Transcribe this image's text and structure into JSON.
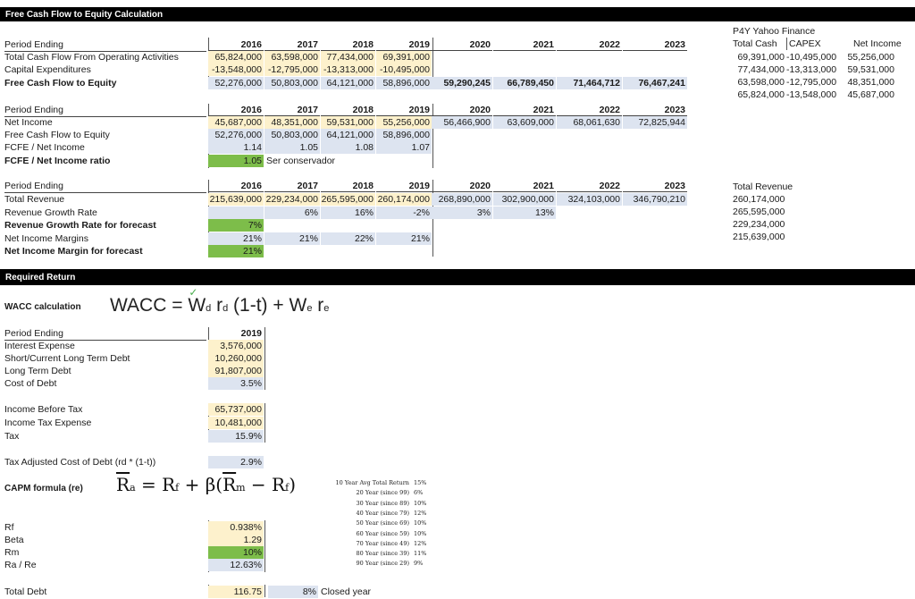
{
  "fcfe": {
    "title": "Free Cash Flow to Equity Calculation",
    "header": "Period Ending",
    "years": [
      "2016",
      "2017",
      "2018",
      "2019",
      "2020",
      "2021",
      "2022",
      "2023"
    ],
    "rows": [
      {
        "label": "Total Cash Flow From Operating Activities",
        "values": [
          "65,824,000",
          "63,598,000",
          "77,434,000",
          "69,391,000"
        ]
      },
      {
        "label": "Capital Expenditures",
        "values": [
          "-13,548,000",
          "-12,795,000",
          "-13,313,000",
          "-10,495,000"
        ]
      },
      {
        "label": "Free Cash Flow to Equity",
        "values": [
          "52,276,000",
          "50,803,000",
          "64,121,000",
          "58,896,000",
          "59,290,245",
          "66,789,450",
          "71,464,712",
          "76,467,241"
        ]
      }
    ]
  },
  "yahoo": {
    "title": "P4Y Yahoo Finance",
    "h1": "Total Cash",
    "h2": "CAPEX",
    "h3": "Net Income",
    "rows": [
      [
        "69,391,000",
        "-10,495,000",
        "55,256,000"
      ],
      [
        "77,434,000",
        "-13,313,000",
        "59,531,000"
      ],
      [
        "63,598,000",
        "-12,795,000",
        "48,351,000"
      ],
      [
        "65,824,000",
        "-13,548,000",
        "45,687,000"
      ]
    ]
  },
  "ni": {
    "header": "Period Ending",
    "years": [
      "2016",
      "2017",
      "2018",
      "2019",
      "2020",
      "2021",
      "2022",
      "2023"
    ],
    "net_income_label": "Net Income",
    "net_income": [
      "45,687,000",
      "48,351,000",
      "59,531,000",
      "55,256,000",
      "56,466,900",
      "63,609,000",
      "68,061,630",
      "72,825,944"
    ],
    "fcfe_label": "Free Cash Flow to Equity",
    "fcfe": [
      "52,276,000",
      "50,803,000",
      "64,121,000",
      "58,896,000"
    ],
    "ratio_label": "FCFE / Net Income",
    "ratio": [
      "1.14",
      "1.05",
      "1.08",
      "1.07"
    ],
    "ratio_forecast_label": "FCFE / Net Income ratio",
    "ratio_forecast": "1.05",
    "note": "Ser conservador"
  },
  "rev": {
    "header": "Period Ending",
    "years": [
      "2016",
      "2017",
      "2018",
      "2019",
      "2020",
      "2021",
      "2022",
      "2023"
    ],
    "total_label": "Total Revenue",
    "total": [
      "215,639,000",
      "229,234,000",
      "265,595,000",
      "260,174,000",
      "268,890,000",
      "302,900,000",
      "324,103,000",
      "346,790,210"
    ],
    "growth_label": "Revenue Growth Rate",
    "growth": [
      "",
      "6%",
      "16%",
      "-2%",
      "3%",
      "13%"
    ],
    "growth_forecast_label": "Revenue Growth Rate for forecast",
    "growth_forecast": "7%",
    "margin_label": "Net Income Margins",
    "margins": [
      "21%",
      "21%",
      "22%",
      "21%"
    ],
    "margin_forecast_label": "Net Income Margin for forecast",
    "margin_forecast": "21%",
    "side_title": "Total Revenue",
    "side_values": [
      "260,174,000",
      "265,595,000",
      "229,234,000",
      "215,639,000"
    ]
  },
  "rr": {
    "title": "Required Return",
    "wacc_label": "WACC calculation",
    "wacc_formula": "WACC = Wd rd (1-t) + We re",
    "header": "Period Ending",
    "year": "2019",
    "interest_label": "Interest Expense",
    "interest": "3,576,000",
    "short_label": "Short/Current Long Term Debt",
    "short": "10,260,000",
    "long_label": "Long Term Debt",
    "long": "91,807,000",
    "cod_label": "Cost of Debt",
    "cod": "3.5%",
    "ibt_label": "Income Before Tax",
    "ibt": "65,737,000",
    "ite_label": "Income Tax Expense",
    "ite": "10,481,000",
    "tax_label": "Tax",
    "tax": "15.9%",
    "tacod_label": "Tax Adjusted Cost of Debt (rd * (1-t))",
    "tacod": "2.9%",
    "capm_label": "CAPM formula (re)",
    "capm_formula": "Ra = Rf + β(Rm − Rf)",
    "returns": [
      [
        "10 Year Avg Total Return",
        "15%"
      ],
      [
        "20 Year (since 99)",
        "6%"
      ],
      [
        "30 Year (since 89)",
        "10%"
      ],
      [
        "40 Year (since 79)",
        "12%"
      ],
      [
        "50 Year (since 69)",
        "10%"
      ],
      [
        "60 Year (since 59)",
        "10%"
      ],
      [
        "70 Year (since 49)",
        "12%"
      ],
      [
        "80 Year (since 39)",
        "11%"
      ],
      [
        "90 Year (since 29)",
        "9%"
      ]
    ],
    "rf_label": "Rf",
    "rf": "0.938%",
    "beta_label": "Beta",
    "beta": "1.29",
    "rm_label": "Rm",
    "rm": "10%",
    "rare_label": "Ra / Re",
    "rare": "12.63%",
    "td_label": "Total Debt",
    "td": "116.75",
    "closed_pct": "8%",
    "closed_label": "Closed year"
  }
}
